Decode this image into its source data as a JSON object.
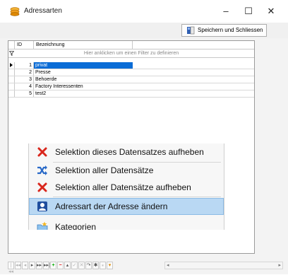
{
  "window": {
    "title": "Adressarten",
    "minimize_glyph": "–",
    "maximize_glyph": "☐",
    "close_glyph": "✕"
  },
  "toolbar": {
    "save_label": "Speichern und Schliessen",
    "save_icon": "save-close-icon"
  },
  "grid": {
    "columns": [
      "ID",
      "Bezeichnung"
    ],
    "filter_placeholder": "Hier anklicken um einen Filter zu definieren",
    "rows": [
      {
        "id": "1",
        "bezeichnung": "privat",
        "selected": true
      },
      {
        "id": "2",
        "bezeichnung": "Presse",
        "selected": false
      },
      {
        "id": "3",
        "bezeichnung": "Behoerde",
        "selected": false
      },
      {
        "id": "4",
        "bezeichnung": "Factory Interessenten",
        "selected": false
      },
      {
        "id": "5",
        "bezeichnung": "test2",
        "selected": false
      }
    ]
  },
  "context_menu": {
    "items": [
      {
        "label": "Selektion dieses Datensatzes aufheben",
        "icon": "red-x-icon"
      },
      {
        "label": "Selektion aller Datensätze",
        "icon": "shuffle-arrows-icon"
      },
      {
        "label": "Selektion aller Datensätze aufheben",
        "icon": "red-x-icon"
      },
      {
        "label": "Adressart der Adresse ändern",
        "icon": "user-badge-icon",
        "highlighted": true
      },
      {
        "label": "Kategorien",
        "icon": "folder-star-icon"
      }
    ]
  },
  "navigator": {
    "buttons": [
      "|◂◂",
      "◂◂",
      "◂",
      "▸",
      "▸▸",
      "▸▸|",
      "+",
      "−",
      "▴",
      "✓",
      "✕",
      "↷",
      "✱",
      "⁎",
      "▾"
    ],
    "scroll_left": "◂",
    "scroll_right": "▸"
  },
  "colors": {
    "selection": "#0a6cd6",
    "menu_highlight": "#b9d8f3",
    "app_icon": "#f0a020"
  }
}
